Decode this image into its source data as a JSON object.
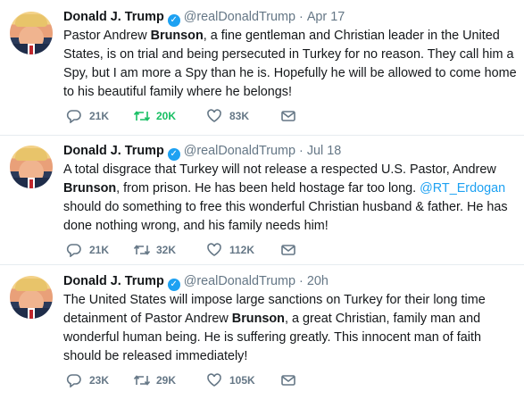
{
  "colors": {
    "link": "#1da1f2",
    "muted": "#657786",
    "retweet_active": "#17bf63",
    "verified": "#1da1f2"
  },
  "tweets": [
    {
      "name": "Donald J. Trump",
      "handle": "@realDonaldTrump",
      "separator": "·",
      "time": "Apr 17",
      "text_segments": [
        {
          "t": "Pastor Andrew "
        },
        {
          "t": "Brunson",
          "b": true
        },
        {
          "t": ", a fine gentleman and Christian leader in the United States, is on trial and being persecuted in Turkey for no reason. They call him a Spy, but I am more a Spy than he is. Hopefully he will be allowed to come home to his beautiful family where he belongs!"
        }
      ],
      "replies": "21K",
      "retweets": "20K",
      "retweeted": true,
      "likes": "83K"
    },
    {
      "name": "Donald J. Trump",
      "handle": "@realDonaldTrump",
      "separator": "·",
      "time": "Jul 18",
      "text_segments": [
        {
          "t": "A total disgrace that Turkey will not release a respected U.S. Pastor, Andrew "
        },
        {
          "t": "Brunson",
          "b": true
        },
        {
          "t": ", from prison. He has been held hostage far too long. "
        },
        {
          "t": "@RT_Erdogan",
          "m": true
        },
        {
          "t": " should do something to free this wonderful Christian husband & father. He has done nothing wrong, and his family needs him!"
        }
      ],
      "replies": "21K",
      "retweets": "32K",
      "retweeted": false,
      "likes": "112K"
    },
    {
      "name": "Donald J. Trump",
      "handle": "@realDonaldTrump",
      "separator": "·",
      "time": "20h",
      "text_segments": [
        {
          "t": "The United States will impose large sanctions on Turkey for their long time detainment of Pastor Andrew "
        },
        {
          "t": "Brunson",
          "b": true
        },
        {
          "t": ", a great Christian, family man and wonderful human being. He is suffering greatly. This innocent man of faith should be released immediately!"
        }
      ],
      "replies": "23K",
      "retweets": "29K",
      "retweeted": false,
      "likes": "105K"
    }
  ]
}
